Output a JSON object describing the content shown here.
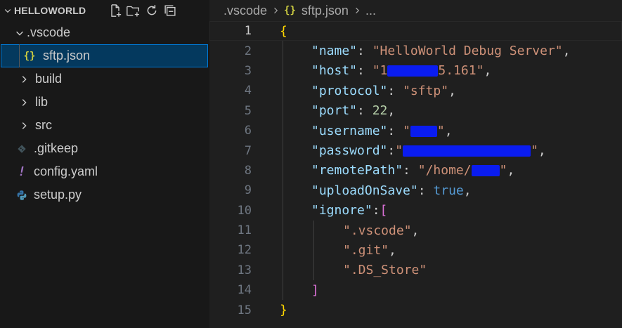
{
  "explorer": {
    "title": "HELLOWORLD",
    "actions": [
      {
        "name": "new-file-icon"
      },
      {
        "name": "new-folder-icon"
      },
      {
        "name": "refresh-icon"
      },
      {
        "name": "collapse-all-icon"
      }
    ],
    "items": [
      {
        "label": ".vscode",
        "type": "folder",
        "expanded": true,
        "depth": 0
      },
      {
        "label": "sftp.json",
        "type": "json",
        "depth": 1,
        "selected": true
      },
      {
        "label": "build",
        "type": "folder",
        "expanded": false,
        "depth": 0
      },
      {
        "label": "lib",
        "type": "folder",
        "expanded": false,
        "depth": 0
      },
      {
        "label": "src",
        "type": "folder",
        "expanded": false,
        "depth": 0
      },
      {
        "label": ".gitkeep",
        "type": "gitkeep",
        "depth": 0
      },
      {
        "label": "config.yaml",
        "type": "yaml",
        "depth": 0
      },
      {
        "label": "setup.py",
        "type": "python",
        "depth": 0
      }
    ]
  },
  "breadcrumb": {
    "folder": ".vscode",
    "file": "sftp.json",
    "ellipsis": "..."
  },
  "editor": {
    "active_line": 1,
    "lines": [
      {
        "n": "1"
      },
      {
        "n": "2",
        "key": "\"name\"",
        "val": "\"HelloWorld Debug Server\""
      },
      {
        "n": "3",
        "key": "\"host\"",
        "val_start": "\"1",
        "val_end": "5.161\""
      },
      {
        "n": "4",
        "key": "\"protocol\"",
        "val": "\"sftp\""
      },
      {
        "n": "5",
        "key": "\"port\"",
        "num": "22"
      },
      {
        "n": "6",
        "key": "\"username\"",
        "val_start": "\"",
        "val_end": "\""
      },
      {
        "n": "7",
        "key": "\"password\"",
        "val_start": "\"",
        "val_end": "\""
      },
      {
        "n": "8",
        "key": "\"remotePath\"",
        "val_start": "\"/home/",
        "val_end": "\""
      },
      {
        "n": "9",
        "key": "\"uploadOnSave\"",
        "bool": "true"
      },
      {
        "n": "10",
        "key": "\"ignore\""
      },
      {
        "n": "11",
        "val": "\".vscode\""
      },
      {
        "n": "12",
        "val": "\".git\""
      },
      {
        "n": "13",
        "val": "\".DS_Store\""
      },
      {
        "n": "14"
      },
      {
        "n": "15"
      }
    ]
  },
  "colors": {
    "sidebar_bg": "#181818",
    "editor_bg": "#1f1f1f",
    "selection_bg": "#04395e",
    "selection_border": "#0078d4",
    "json_key": "#9cdcfe",
    "json_string": "#ce9178",
    "json_number": "#b5cea8",
    "json_bool": "#569cd6",
    "bracket_level1": "#ffd700",
    "bracket_level2": "#da70d6",
    "redaction": "#0a1cf0"
  }
}
